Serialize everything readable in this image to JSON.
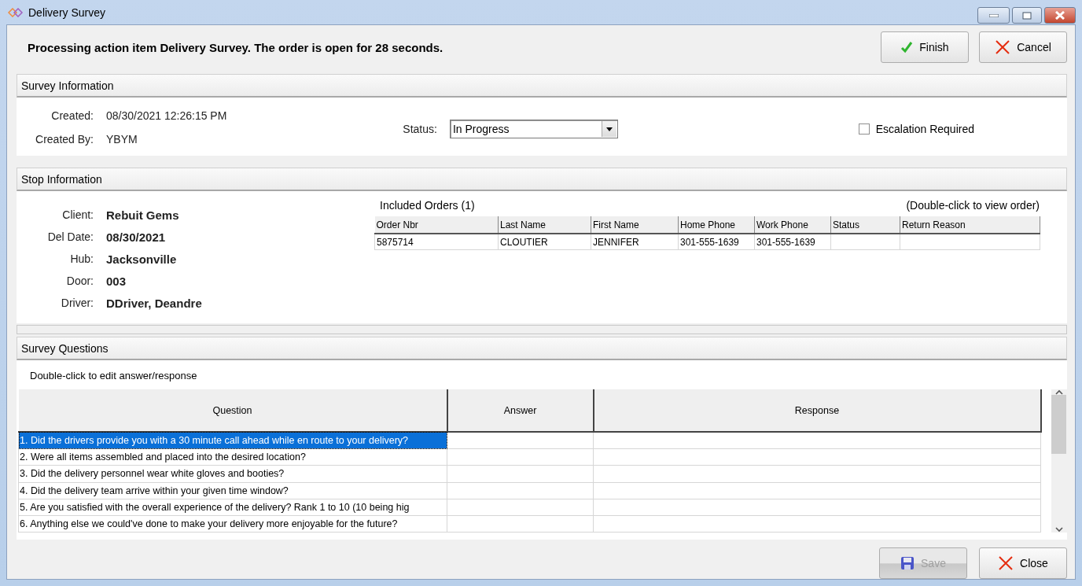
{
  "window": {
    "title": "Delivery Survey"
  },
  "message": "Processing action item Delivery Survey. The order is open for 28 seconds.",
  "top_buttons": [
    {
      "label": "Finish",
      "kind": "check",
      "disabled": false
    },
    {
      "label": "Cancel",
      "kind": "cross",
      "disabled": false
    }
  ],
  "survey_information": {
    "title": "Survey Information",
    "fields": [
      {
        "label": "Created:",
        "value": "08/30/2021 12:26:15 PM"
      },
      {
        "label": "Created By:",
        "value": "YBYM"
      }
    ],
    "status": {
      "label": "Status:",
      "value": "In Progress"
    },
    "escalation": {
      "label": "Escalation Required",
      "checked": false
    }
  },
  "stop_information": {
    "title": "Stop Information",
    "fields": [
      {
        "label": "Client:",
        "value": "Rebuit Gems"
      },
      {
        "label": "Del Date:",
        "value": "08/30/2021"
      },
      {
        "label": "Hub:",
        "value": "Jacksonville"
      },
      {
        "label": "Door:",
        "value": "003"
      },
      {
        "label": "Driver:",
        "value": "DDriver, Deandre"
      }
    ],
    "included_orders": {
      "title": "Included Orders (1)",
      "hint": "(Double-click to view order)",
      "columns": [
        "Order Nbr",
        "Last Name",
        "First Name",
        "Home Phone",
        "Work Phone",
        "Status",
        "Return Reason"
      ],
      "rows": [
        [
          "5875714",
          "CLOUTIER",
          "JENNIFER",
          "301-555-1639",
          "301-555-1639",
          "",
          ""
        ]
      ]
    }
  },
  "survey_questions": {
    "title": "Survey Questions",
    "hint": "Double-click to edit answer/response",
    "columns": [
      "Question",
      "Answer",
      "Response"
    ],
    "rows": [
      {
        "question": "1. Did the drivers provide you with a 30 minute call ahead while en route to your delivery?",
        "answer": "",
        "response": "",
        "selected": true
      },
      {
        "question": "2. Were all items assembled and placed into the desired location?",
        "answer": "",
        "response": "",
        "selected": false
      },
      {
        "question": "3. Did the delivery personnel wear white gloves and booties?",
        "answer": "",
        "response": "",
        "selected": false
      },
      {
        "question": "4. Did the delivery team arrive within your given time window?",
        "answer": "",
        "response": "",
        "selected": false
      },
      {
        "question": "5. Are you satisfied with the overall experience of the delivery? Rank 1 to 10 (10 being hig",
        "answer": "",
        "response": "",
        "selected": false
      },
      {
        "question": "6. Anything else we could've done to make your delivery more enjoyable for the future?",
        "answer": "",
        "response": "",
        "selected": false
      }
    ]
  },
  "bottom_buttons": [
    {
      "label": "Save",
      "kind": "save",
      "disabled": true
    },
    {
      "label": "Close",
      "kind": "cross",
      "disabled": false
    }
  ]
}
